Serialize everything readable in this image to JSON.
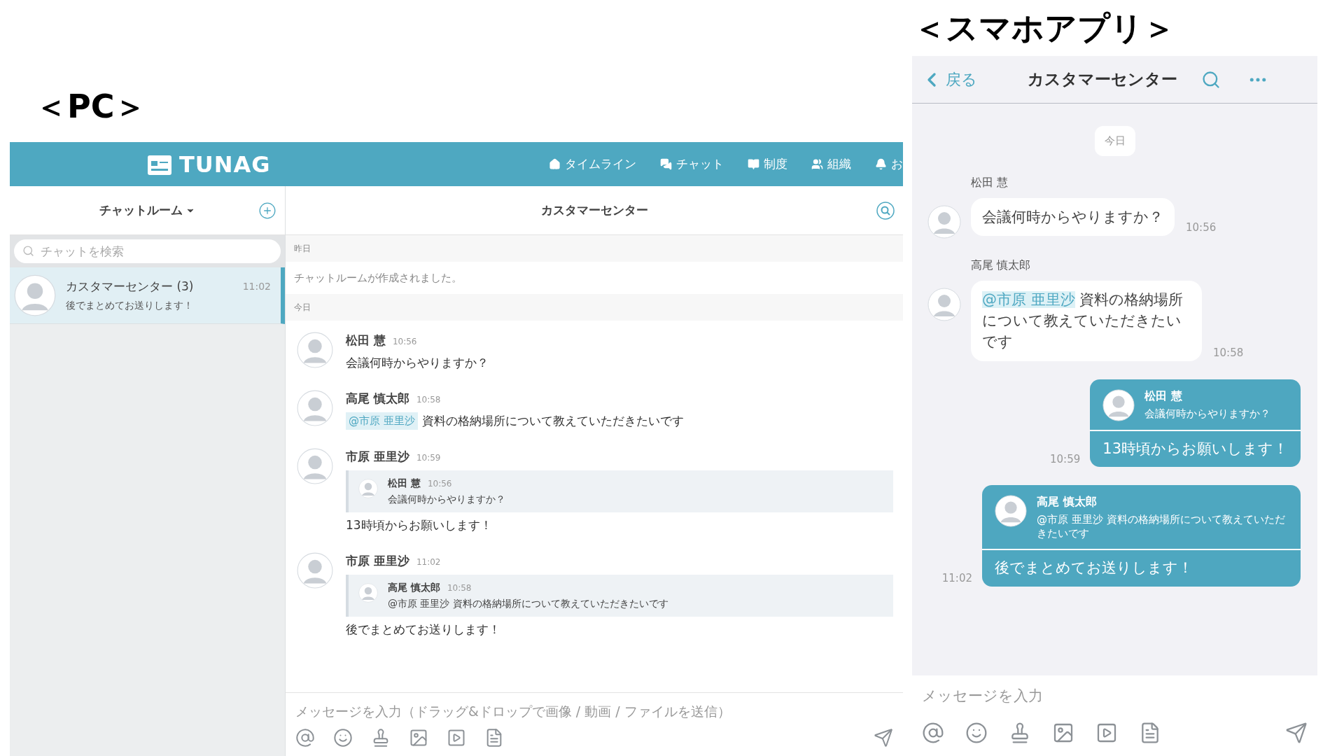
{
  "pc": {
    "label": "＜PC＞",
    "header": {
      "logo": "TUNAG",
      "nav": [
        {
          "label": "タイムライン"
        },
        {
          "label": "チャット"
        },
        {
          "label": "制度"
        },
        {
          "label": "組織"
        },
        {
          "label": "お"
        }
      ]
    },
    "sidebar": {
      "title": "チャットルーム",
      "search": {
        "placeholder": "チャットを検索"
      },
      "rooms": [
        {
          "name": "カスタマーセンター (3)",
          "time": "11:02",
          "preview": "後でまとめてお送りします！",
          "selected": true
        }
      ]
    },
    "chat": {
      "title": "カスタマーセンター",
      "events": [
        {
          "kind": "date",
          "text": "昨日"
        },
        {
          "kind": "system",
          "text": "チャットルームが作成されました。"
        },
        {
          "kind": "date",
          "text": "今日"
        },
        {
          "kind": "message",
          "author": "松田 慧",
          "time": "10:56",
          "text": "会議何時からやりますか？"
        },
        {
          "kind": "message",
          "author": "高尾 慎太郎",
          "time": "10:58",
          "mention": "@市原 亜里沙",
          "text": "資料の格納場所について教えていただきたいです"
        },
        {
          "kind": "message",
          "author": "市原 亜里沙",
          "time": "10:59",
          "quote": {
            "author": "松田 慧",
            "time": "10:56",
            "text": "会議何時からやりますか？"
          },
          "text": "13時頃からお願いします！"
        },
        {
          "kind": "message",
          "author": "市原 亜里沙",
          "time": "11:02",
          "quote": {
            "author": "高尾 慎太郎",
            "time": "10:58",
            "text": "@市原 亜里沙 資料の格納場所について教えていただきたいです"
          },
          "text": "後でまとめてお送りします！"
        }
      ]
    },
    "composer": {
      "placeholder": "メッセージを入力（ドラッグ&ドロップで画像 / 動画 / ファイルを送信）"
    }
  },
  "phone": {
    "label": "＜スマホアプリ＞",
    "header": {
      "back": "戻る",
      "title": "カスタマーセンター"
    },
    "date": "今日",
    "messages": [
      {
        "kind": "incoming",
        "author": "松田 慧",
        "text": "会議何時からやりますか？",
        "time": "10:56"
      },
      {
        "kind": "incoming",
        "author": "高尾 慎太郎",
        "mention": "@市原 亜里沙",
        "text": "資料の格納場所について教えていただきたいです",
        "time": "10:58"
      },
      {
        "kind": "outgoing",
        "quote": {
          "author": "松田 慧",
          "text": "会議何時からやりますか？"
        },
        "text": "13時頃からお願いします！",
        "time": "10:59"
      },
      {
        "kind": "outgoing",
        "quote": {
          "author": "高尾 慎太郎",
          "text": "@市原 亜里沙 資料の格納場所について教えていただきたいです"
        },
        "text": "後でまとめてお送りします！",
        "time": "11:02"
      }
    ],
    "composer": {
      "placeholder": "メッセージを入力"
    }
  }
}
